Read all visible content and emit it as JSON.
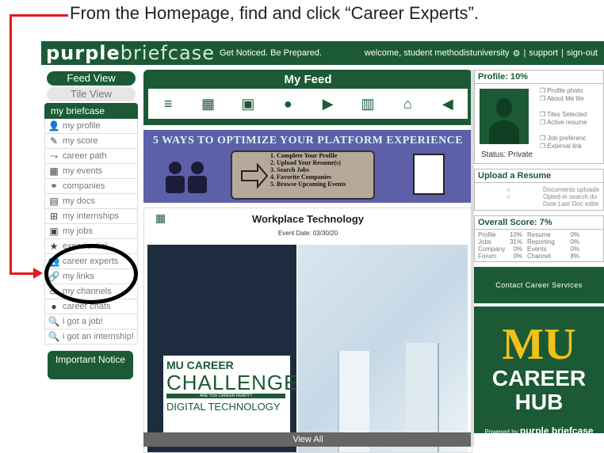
{
  "instruction": "From the Homepage, find and click “Career Experts”.",
  "topbar": {
    "logo_bold": "purple",
    "logo_light": "briefcase",
    "tagline": "Get Noticed. Be Prepared.",
    "welcome": "welcome, student methodistuniversity",
    "settings_icon": "⚙",
    "sep": "|",
    "support": "support",
    "signout": "sign-out"
  },
  "sidebar": {
    "feed_view": "Feed View",
    "tile_view": "Tile View",
    "briefcase_title": "my briefcase",
    "items": [
      {
        "icon": "👤",
        "label": "my profile"
      },
      {
        "icon": "✎",
        "label": "my score"
      },
      {
        "icon": "⤳",
        "label": "career path"
      },
      {
        "icon": "▦",
        "label": "my events"
      },
      {
        "icon": "⚭",
        "label": "companies"
      },
      {
        "icon": "▤",
        "label": "my docs"
      },
      {
        "icon": "⊞",
        "label": "my internships"
      },
      {
        "icon": "▣",
        "label": "my jobs"
      },
      {
        "icon": "★",
        "label": "experiential"
      },
      {
        "icon": "👥",
        "label": "career experts"
      },
      {
        "icon": "🔗",
        "label": "my links"
      },
      {
        "icon": "▭",
        "label": "my channels"
      },
      {
        "icon": "●",
        "label": "career chats"
      },
      {
        "icon": "🔍",
        "label": "i got a job!"
      },
      {
        "icon": "🔍",
        "label": "i got an internship!"
      }
    ],
    "important": "Important Notice"
  },
  "feed": {
    "title": "My Feed",
    "icons": [
      "≡",
      "▦",
      "▣",
      "●",
      "▶",
      "▥",
      "⌂",
      "◀"
    ],
    "banner_title": "5 WAYS TO OPTIMIZE YOUR PLATFORM EXPERIENCE",
    "banner_steps": [
      "1. Complete Your Profile",
      "2. Upload Your Resume(s)",
      "3. Search Jobs",
      "4. Favorite Companies",
      "5. Browse Upcoming Events"
    ],
    "event_title": "Workplace Technology",
    "event_date": "Event Date: 03/30/20",
    "event_mu": "MU CAREER",
    "event_challenge": "CHALLENGE",
    "event_ready": "ARE YOU CAREER READY?",
    "event_digital": "DIGITAL TECHNOLOGY",
    "view_all": "View All"
  },
  "profile": {
    "title": "Profile: 10%",
    "status": "Status: Private",
    "checklist": [
      "❒ Profile photo",
      "❒ About Me tile",
      "",
      "❒ Tiles Selected",
      "❒ Active resume",
      "",
      "❒ Job preferenc",
      "❒ External link"
    ]
  },
  "upload": {
    "title": "Upload a Resume",
    "lines": [
      "Documents uploade",
      "Opted-in search do",
      "Date Last Doc edite"
    ]
  },
  "score": {
    "title": "Overall Score: 7%",
    "rows": [
      [
        "Profile",
        "10%",
        "Resume",
        "0%"
      ],
      [
        "Jobs",
        "31%",
        "Reporting",
        "0%"
      ],
      [
        "Company",
        "0%",
        "Events",
        "0%"
      ],
      [
        "Forum",
        "0%",
        "Channel",
        "8%"
      ]
    ]
  },
  "contact": "Contact Career Services",
  "hub": {
    "mu": "MU",
    "career_hub": "CAREER HUB",
    "powered_by": "Powered by",
    "brand": "purple briefcase"
  }
}
